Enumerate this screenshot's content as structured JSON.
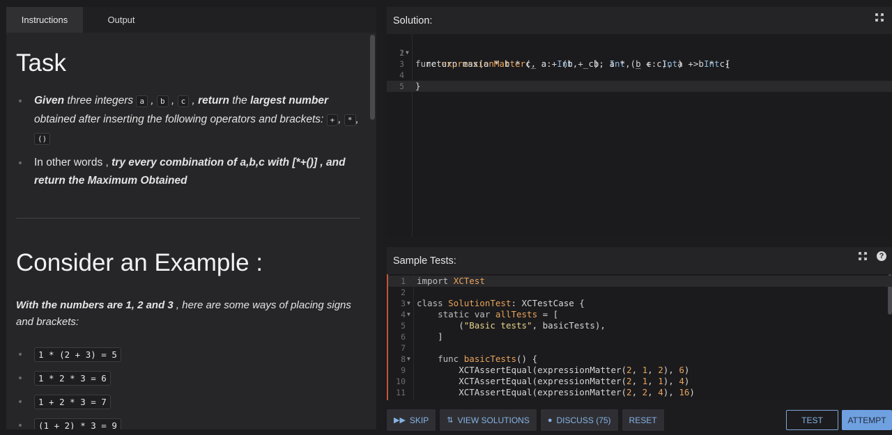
{
  "tabs": [
    "Instructions",
    "Output"
  ],
  "description": {
    "task_title": "Task",
    "bullet1": {
      "given": "Given",
      "three": " three integers ",
      "a": "a",
      "comma1": " , ",
      "b": "b",
      "comma2": " , ",
      "c": "c",
      "comma3": " , ",
      "return": "return",
      "the": " the ",
      "largest": "largest number",
      "obtained": " obtained after inserting the following operators and brackets: ",
      "op1": "+",
      "sep1": ", ",
      "op2": "*",
      "sep2": ", ",
      "op3": "()"
    },
    "bullet2": {
      "plain": "In other words ,",
      "bold": " try every combination of a,b,c with [*+()] , and return the Maximum Obtained"
    },
    "example_title": "Consider an Example :",
    "example_desc_bold": "With the numbers are 1, 2 and 3",
    "example_desc_rest": " , here are some ways of placing signs and brackets:",
    "examples": [
      "1 * (2 + 3) = 5",
      "1 * 2 * 3 = 6",
      "1 + 2 * 3 = 7",
      "(1 + 2) * 3 = 9"
    ]
  },
  "solution": {
    "title": "Solution:",
    "lines": [
      {
        "n": "1",
        "fold": true
      },
      {
        "n": "2",
        "fold": false
      },
      {
        "n": "3",
        "fold": false
      },
      {
        "n": "4",
        "fold": false
      },
      {
        "n": "5",
        "fold": false
      }
    ],
    "code": {
      "l1_kw": "func ",
      "l1_fn": "expressionMatter",
      "l1_a": "(_ a: ",
      "l1_t1": "Int",
      "l1_b": ", _ b: ",
      "l1_t2": "Int",
      "l1_c": ", _ c: ",
      "l1_t3": "Int",
      "l1_ret": ") -> ",
      "l1_t4": "Int",
      "l1_end": " {",
      "l3": "  return max(a * b * c, a + (b + c), a * (b + c), a + b * c)",
      "l5": "}"
    }
  },
  "tests": {
    "title": "Sample Tests:",
    "lines": [
      {
        "n": "1",
        "fold": false
      },
      {
        "n": "2",
        "fold": false
      },
      {
        "n": "3",
        "fold": true
      },
      {
        "n": "4",
        "fold": true
      },
      {
        "n": "5",
        "fold": false
      },
      {
        "n": "6",
        "fold": false
      },
      {
        "n": "7",
        "fold": false
      },
      {
        "n": "8",
        "fold": true
      },
      {
        "n": "9",
        "fold": false
      },
      {
        "n": "10",
        "fold": false
      },
      {
        "n": "11",
        "fold": false
      }
    ],
    "code": {
      "l1_kw": "import ",
      "l1_mod": "XCTest",
      "l3_kw": "class ",
      "l3_name": "SolutionTest",
      "l3_rest": ": XCTestCase {",
      "l4_kw": "    static var ",
      "l4_name": "allTests",
      "l4_rest": " = [",
      "l5_pre": "        (",
      "l5_str": "\"Basic tests\"",
      "l5_rest": ", basicTests),",
      "l6": "    ]",
      "l8_kw": "    func ",
      "l8_name": "basicTests",
      "l8_rest": "() {",
      "l9_pre": "        XCTAssertEqual(expressionMatter(",
      "l9_n1": "2",
      "l9_s1": ", ",
      "l9_n2": "1",
      "l9_s2": ", ",
      "l9_n3": "2",
      "l9_s3": "), ",
      "l9_n4": "6",
      "l9_end": ")",
      "l10_pre": "        XCTAssertEqual(expressionMatter(",
      "l10_n1": "2",
      "l10_s1": ", ",
      "l10_n2": "1",
      "l10_s2": ", ",
      "l10_n3": "1",
      "l10_s3": "), ",
      "l10_n4": "4",
      "l10_end": ")",
      "l11_pre": "        XCTAssertEqual(expressionMatter(",
      "l11_n1": "2",
      "l11_s1": ", ",
      "l11_n2": "2",
      "l11_s2": ", ",
      "l11_n3": "4",
      "l11_s3": "), ",
      "l11_n4": "16",
      "l11_end": ")"
    }
  },
  "actions": {
    "skip": "SKIP",
    "view_solutions": "VIEW SOLUTIONS",
    "discuss": "DISCUSS (75)",
    "reset": "RESET",
    "test": "TEST",
    "attempt": "ATTEMPT"
  },
  "icons": {
    "expand": "expand-icon",
    "help": "help-icon",
    "skip": "skip-icon",
    "solutions": "solutions-icon",
    "discuss": "discuss-icon"
  }
}
